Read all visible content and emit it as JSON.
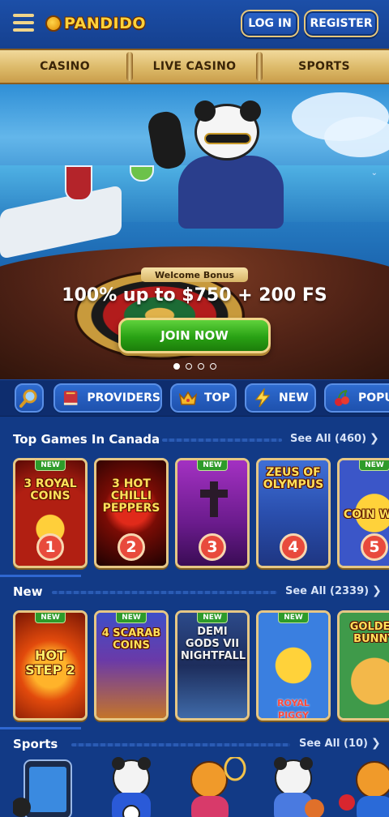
{
  "header": {
    "logo_text": "PANDIDO",
    "login_label": "LOG IN",
    "register_label": "REGISTER"
  },
  "tabs": [
    {
      "label": "CASINO"
    },
    {
      "label": "LIVE CASINO"
    },
    {
      "label": "SPORTS"
    }
  ],
  "hero": {
    "badge": "Welcome Bonus",
    "title": "100% up to $750 + 200 FS",
    "cta": "JOIN NOW",
    "slides_total": 4,
    "slide_active": 1
  },
  "filters": [
    {
      "label": ""
    },
    {
      "label": "PROVIDERS"
    },
    {
      "label": "TOP"
    },
    {
      "label": "NEW"
    },
    {
      "label": "POPU"
    }
  ],
  "sections": {
    "top": {
      "title": "Top Games In Canada",
      "see_all": "See All (460)",
      "games": [
        {
          "name": "3 ROYAL COINS",
          "rank": "1",
          "new_badge": "NEW"
        },
        {
          "name": "3 HOT CHILLI PEPPERS",
          "rank": "2",
          "new_badge": ""
        },
        {
          "name": "",
          "rank": "3",
          "new_badge": "NEW"
        },
        {
          "name": "ZEUS OF OLYMPUS",
          "rank": "4",
          "new_badge": ""
        },
        {
          "name": "COIN WIN",
          "rank": "5",
          "new_badge": "NEW"
        }
      ]
    },
    "new": {
      "title": "New",
      "see_all": "See All (2339)",
      "games": [
        {
          "name": "HOT STEP 2",
          "new_badge": "NEW"
        },
        {
          "name": "4 SCARAB COINS",
          "new_badge": "NEW"
        },
        {
          "name": "DEMI GODS VII NIGHTFALL",
          "new_badge": "NEW"
        },
        {
          "name": "ROYAL PIGGY",
          "new_badge": "NEW"
        },
        {
          "name": "GOLDEN BUNNY",
          "new_badge": ""
        }
      ]
    },
    "sports": {
      "title": "Sports",
      "see_all": "See All (10)"
    }
  },
  "colors": {
    "background": "#123a86",
    "gold_border": "#e6c785",
    "join_green": "#29a114",
    "rank_red": "#e84a3c",
    "new_green": "#2e9b2a"
  }
}
